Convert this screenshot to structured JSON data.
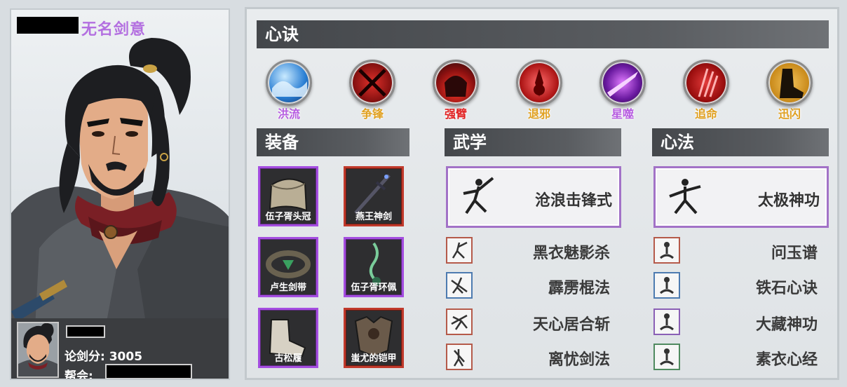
{
  "character": {
    "name": "无名剑意",
    "score_text": "论剑分: 3005",
    "guild_label": "帮会:"
  },
  "sections": {
    "xinjue": "心诀",
    "equipment": "装备",
    "wuxue": "武学",
    "xinfa": "心法"
  },
  "skills": [
    {
      "label": "洪流",
      "color": "#b65ce0",
      "icon": "water-wave-icon"
    },
    {
      "label": "争锋",
      "color": "#e0a020",
      "icon": "crossed-blades-icon"
    },
    {
      "label": "强臂",
      "color": "#e02020",
      "icon": "demon-arm-icon"
    },
    {
      "label": "退邪",
      "color": "#e0a020",
      "icon": "red-temple-icon"
    },
    {
      "label": "星噬",
      "color": "#b65ce0",
      "icon": "purple-slash-icon"
    },
    {
      "label": "追命",
      "color": "#e0a020",
      "icon": "red-claw-icon"
    },
    {
      "label": "迅闪",
      "color": "#e0a020",
      "icon": "boot-icon"
    }
  ],
  "equipment": [
    {
      "name": "伍子胥头冠",
      "rarity": "purple",
      "icon": "helmet-icon"
    },
    {
      "name": "燕王神剑",
      "rarity": "red",
      "icon": "sword-icon"
    },
    {
      "name": "卢生剑带",
      "rarity": "purple",
      "icon": "belt-icon"
    },
    {
      "name": "伍子胥环佩",
      "rarity": "purple",
      "icon": "pendant-icon"
    },
    {
      "name": "古松履",
      "rarity": "purple",
      "icon": "shoes-icon"
    },
    {
      "name": "蚩尤的铠甲",
      "rarity": "red",
      "icon": "armor-icon"
    }
  ],
  "wuxue": {
    "main": "沧浪击锋式",
    "list": [
      {
        "name": "黑衣魅影杀",
        "tier": "red"
      },
      {
        "name": "霹雳棍法",
        "tier": "blue"
      },
      {
        "name": "天心居合斩",
        "tier": "red"
      },
      {
        "name": "离忧剑法",
        "tier": "red"
      }
    ]
  },
  "xinfa": {
    "main": "太极神功",
    "list": [
      {
        "name": "问玉谱",
        "tier": "red"
      },
      {
        "name": "铁石心诀",
        "tier": "blue"
      },
      {
        "name": "大藏神功",
        "tier": "purple"
      },
      {
        "name": "素衣心经",
        "tier": "green"
      }
    ]
  }
}
